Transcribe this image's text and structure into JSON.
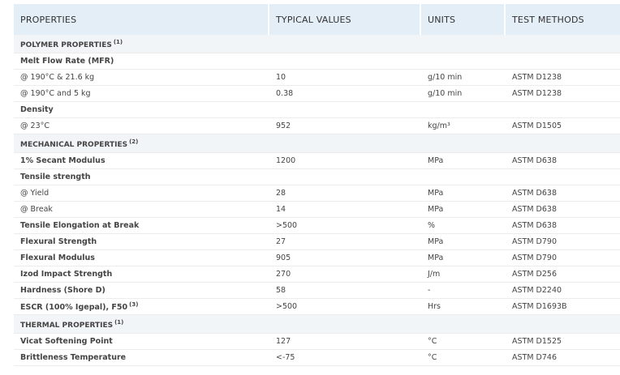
{
  "headers": [
    "PROPERTIES",
    "TYPICAL VALUES",
    "UNITS",
    "TEST METHODS"
  ],
  "rows": [
    {
      "kind": "section",
      "label": "POLYMER PROPERTIES",
      "sup": "(1)"
    },
    {
      "kind": "group",
      "label": "Melt Flow Rate (MFR)"
    },
    {
      "kind": "data",
      "label": "@ 190°C & 21.6 kg",
      "value": "10",
      "unit": "g/10 min",
      "method": "ASTM D1238"
    },
    {
      "kind": "data",
      "label": "@ 190°C and 5 kg",
      "value": "0.38",
      "unit": "g/10 min",
      "method": "ASTM D1238"
    },
    {
      "kind": "group",
      "label": "Density"
    },
    {
      "kind": "data",
      "label": "@ 23°C",
      "value": "952",
      "unit": "kg/m³",
      "method": "ASTM D1505"
    },
    {
      "kind": "section",
      "label": "MECHANICAL PROPERTIES",
      "sup": "(2)"
    },
    {
      "kind": "bold",
      "label": "1% Secant Modulus",
      "value": "1200",
      "unit": "MPa",
      "method": "ASTM D638"
    },
    {
      "kind": "group",
      "label": "Tensile strength"
    },
    {
      "kind": "data",
      "label": "@ Yield",
      "value": "28",
      "unit": "MPa",
      "method": "ASTM D638"
    },
    {
      "kind": "data",
      "label": "@ Break",
      "value": "14",
      "unit": "MPa",
      "method": "ASTM D638"
    },
    {
      "kind": "bold",
      "label": "Tensile Elongation at Break",
      "value": ">500",
      "unit": "%",
      "method": "ASTM D638"
    },
    {
      "kind": "bold",
      "label": "Flexural Strength",
      "value": "27",
      "unit": "MPa",
      "method": "ASTM D790"
    },
    {
      "kind": "bold",
      "label": "Flexural Modulus",
      "value": "905",
      "unit": "MPa",
      "method": "ASTM D790"
    },
    {
      "kind": "bold",
      "label": "Izod Impact Strength",
      "value": "270",
      "unit": "J/m",
      "method": "ASTM D256"
    },
    {
      "kind": "bold",
      "label": "Hardness (Shore D)",
      "value": "58",
      "unit": "-",
      "method": "ASTM D2240"
    },
    {
      "kind": "bold",
      "label": "ESCR (100% Igepal), F50",
      "sup": "(3)",
      "value": ">500",
      "unit": "Hrs",
      "method": "ASTM D1693B"
    },
    {
      "kind": "section",
      "label": "THERMAL PROPERTIES",
      "sup": "(1)"
    },
    {
      "kind": "bold",
      "label": "Vicat Softening Point",
      "value": "127",
      "unit": "°C",
      "method": "ASTM D1525"
    },
    {
      "kind": "bold",
      "label": "Brittleness Temperature",
      "value": "<-75",
      "unit": "°C",
      "method": "ASTM D746"
    }
  ]
}
